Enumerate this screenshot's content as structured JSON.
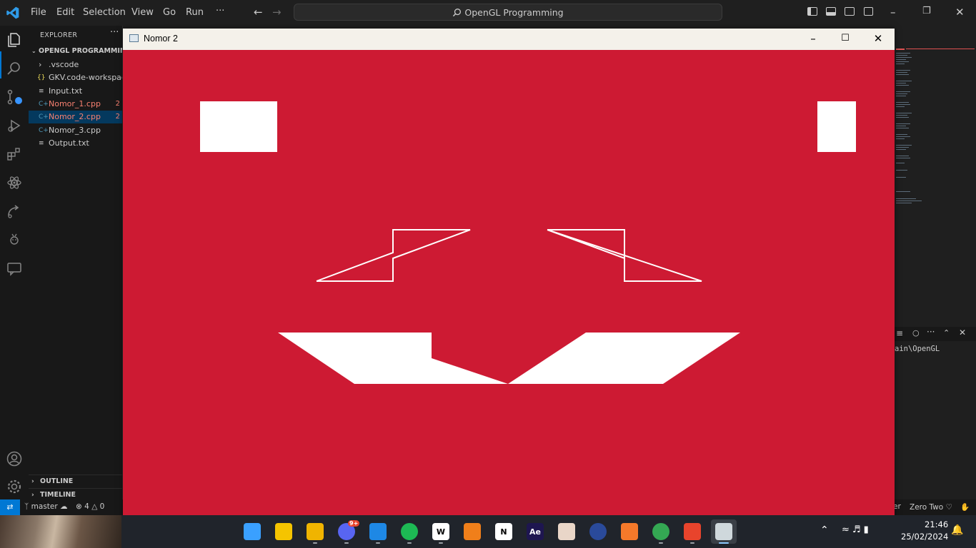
{
  "vscode": {
    "menu": [
      "File",
      "Edit",
      "Selection",
      "View",
      "Go",
      "Run",
      "···"
    ],
    "command_center": "OpenGL Programming",
    "explorer_title": "EXPLORER",
    "workspace_name": "OPENGL PROGRAMMING",
    "files": [
      {
        "name": ".vscode",
        "type": "folder",
        "badge": ""
      },
      {
        "name": "GKV.code-workspace",
        "type": "json",
        "badge": ""
      },
      {
        "name": "Input.txt",
        "type": "text",
        "badge": ""
      },
      {
        "name": "Nomor_1.cpp",
        "type": "cpp",
        "badge": "2"
      },
      {
        "name": "Nomor_2.cpp",
        "type": "cpp",
        "badge": "2"
      },
      {
        "name": "Nomor_3.cpp",
        "type": "cpp",
        "badge": ""
      },
      {
        "name": "Output.txt",
        "type": "text",
        "badge": ""
      }
    ],
    "outline_label": "OUTLINE",
    "timeline_label": "TIMELINE",
    "terminal_path": "ain\\OpenGL",
    "status": {
      "branch": "master",
      "errors": "4",
      "warnings": "0",
      "right_partial": "er",
      "profile": "Zero Two"
    }
  },
  "gl_window": {
    "title": "Nomor 2",
    "background": "#cd1a33",
    "foreground": "#ffffff"
  },
  "taskbar": {
    "apps": [
      {
        "name": "start",
        "label": "",
        "color": "#3aa0ff"
      },
      {
        "name": "sticky-notes",
        "label": "",
        "color": "#f5c400"
      },
      {
        "name": "file-explorer",
        "label": "",
        "color": "#f0b400"
      },
      {
        "name": "discord",
        "label": "9+",
        "color": "#5865f2"
      },
      {
        "name": "vscode",
        "label": "",
        "color": "#1e88e5"
      },
      {
        "name": "spotify",
        "label": "",
        "color": "#1db954"
      },
      {
        "name": "app-w",
        "label": "W",
        "color": "#ffffff"
      },
      {
        "name": "fl-studio",
        "label": "",
        "color": "#f07f1a"
      },
      {
        "name": "notion",
        "label": "N",
        "color": "#ffffff"
      },
      {
        "name": "after-effects",
        "label": "Ae",
        "color": "#1e1650"
      },
      {
        "name": "anime-app",
        "label": "",
        "color": "#e9d6c8"
      },
      {
        "name": "cinema4d",
        "label": "",
        "color": "#2a4a9a"
      },
      {
        "name": "blender",
        "label": "",
        "color": "#f5792a"
      },
      {
        "name": "chrome",
        "label": "",
        "color": "#34a853"
      },
      {
        "name": "app-red",
        "label": "",
        "color": "#e8442c"
      },
      {
        "name": "opengl-window",
        "label": "",
        "color": "#cfd8dc"
      }
    ],
    "time": "21:46",
    "date": "25/02/2024"
  }
}
